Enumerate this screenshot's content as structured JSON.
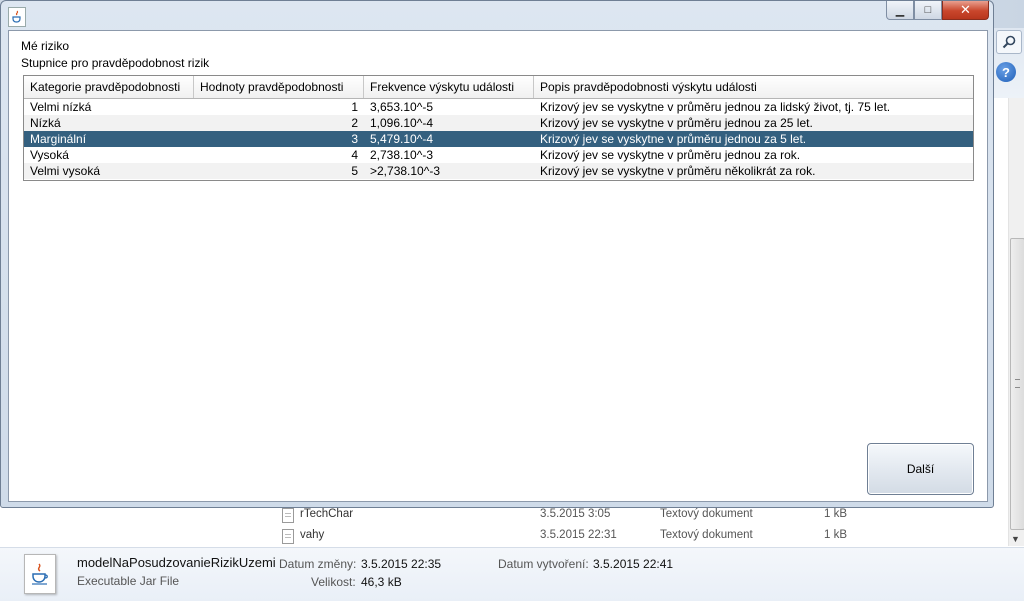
{
  "dialog": {
    "title_label": "Mé riziko",
    "subtitle_label": "Stupnice pro pravděpodobnost rizik",
    "table": {
      "headers": [
        "Kategorie pravděpodobnosti",
        "Hodnoty pravděpodobnosti",
        "Frekvence výskytu události",
        "Popis pravděpodobnosti výskytu události"
      ],
      "rows": [
        [
          "Velmi nízká",
          "1",
          "3,653.10^-5",
          "Krizový jev se vyskytne v průměru jednou za lidský život, tj. 75 let."
        ],
        [
          "Nízká",
          "2",
          "1,096.10^-4",
          "Krizový jev se vyskytne v průměru jednou za 25 let."
        ],
        [
          "Marginální",
          "3",
          "5,479.10^-4",
          "Krizový jev se vyskytne v průměru jednou za 5 let."
        ],
        [
          "Vysoká",
          "4",
          "2,738.10^-3",
          "Krizový jev se vyskytne v průměru jednou za rok."
        ],
        [
          "Velmi vysoká",
          "5",
          ">2,738.10^-3",
          "Krizový jev se vyskytne v průměru několikrát za rok."
        ]
      ],
      "selected_row": 2
    },
    "next_button": "Další",
    "caption_buttons": {
      "minimize": "▁",
      "maximize": "□",
      "close": "✕"
    }
  },
  "explorer": {
    "files": [
      {
        "name": "rTechChar",
        "date": "3.5.2015 3:05",
        "type": "Textový dokument",
        "size": "1 kB"
      },
      {
        "name": "vahy",
        "date": "3.5.2015 22:31",
        "type": "Textový dokument",
        "size": "1 kB"
      }
    ],
    "details": {
      "file_name": "modelNaPosudzovanieRizikUzemi",
      "file_type": "Executable Jar File",
      "modified_label": "Datum změny:",
      "modified_value": "3.5.2015 22:35",
      "created_label": "Datum vytvoření:",
      "created_value": "3.5.2015 22:41",
      "size_label": "Velikost:",
      "size_value": "46,3 kB"
    },
    "help_icon_glyph": "?"
  },
  "colors": {
    "selection": "#34607f",
    "close_button": "#c9462c"
  },
  "icons": [
    "java-app-icon",
    "search-icon",
    "help-icon",
    "text-file-icon",
    "jar-file-icon"
  ]
}
